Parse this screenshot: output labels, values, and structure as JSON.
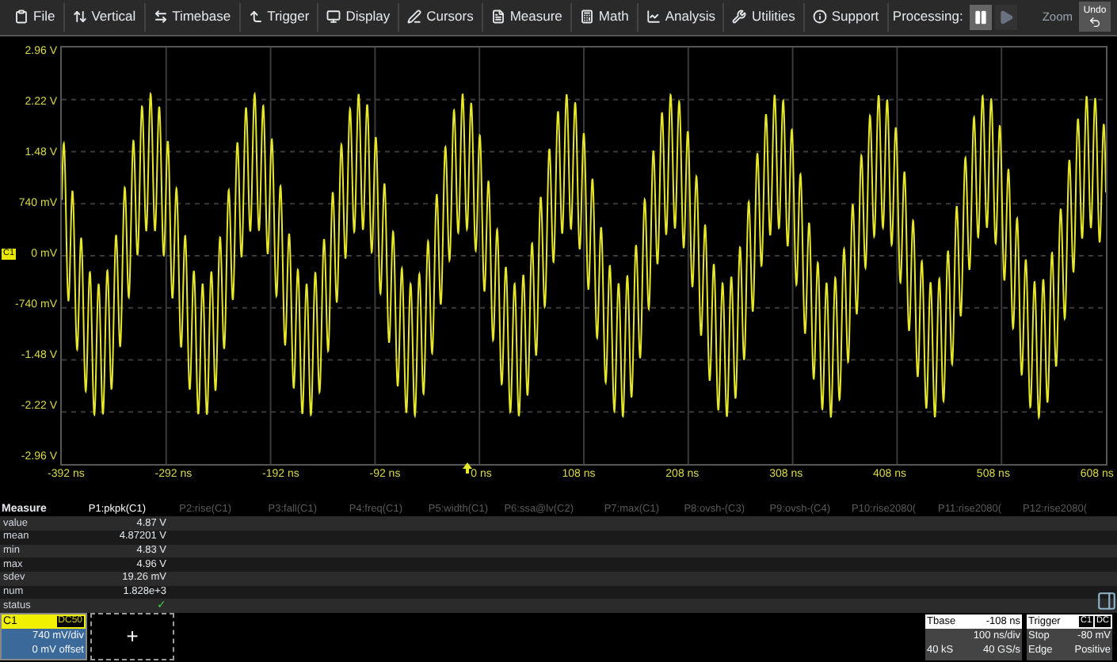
{
  "menu": [
    {
      "label": "File"
    },
    {
      "label": "Vertical"
    },
    {
      "label": "Timebase"
    },
    {
      "label": "Trigger"
    },
    {
      "label": "Display"
    },
    {
      "label": "Cursors"
    },
    {
      "label": "Measure"
    },
    {
      "label": "Math"
    },
    {
      "label": "Analysis"
    },
    {
      "label": "Utilities"
    },
    {
      "label": "Support"
    }
  ],
  "processing": {
    "label": "Processing:",
    "pause": {
      "disabled": false
    },
    "play": {
      "disabled": true
    }
  },
  "zoom": {
    "label": "Zoom"
  },
  "undo": {
    "label": "Undo"
  },
  "y_axis": [
    "2.96 V",
    "2.22 V",
    "1.48 V",
    "740 mV",
    "0 mV",
    "-740 mV",
    "-1.48 V",
    "-2.22 V",
    "-2.96 V"
  ],
  "channel_marker": "C1",
  "x_axis": [
    "-392 ns",
    "-292 ns",
    "-192 ns",
    "-92 ns",
    "0 ns",
    "108 ns",
    "208 ns",
    "308 ns",
    "408 ns",
    "508 ns",
    "608 ns"
  ],
  "measure": {
    "title": "Measure",
    "columns": [
      {
        "label": "P1:pkpk(C1)",
        "selected": true
      },
      {
        "label": "P2:rise(C1)",
        "selected": false
      },
      {
        "label": "P3:fall(C1)",
        "selected": false
      },
      {
        "label": "P4:freq(C1)",
        "selected": false
      },
      {
        "label": "P5:width(C1)",
        "selected": false
      },
      {
        "label": "P6:ssa@lv(C2)",
        "selected": false
      },
      {
        "label": "P7:max(C1)",
        "selected": false
      },
      {
        "label": "P8:ovsh-(C3)",
        "selected": false
      },
      {
        "label": "P9:ovsh-(C4)",
        "selected": false
      },
      {
        "label": "P10:rise2080(",
        "selected": false
      },
      {
        "label": "P11:rise2080(",
        "selected": false
      },
      {
        "label": "P12:rise2080(",
        "selected": false
      }
    ],
    "rows": [
      {
        "label": "value",
        "kind": "text",
        "value": "4.87 V"
      },
      {
        "label": "mean",
        "kind": "text",
        "value": "4.87201 V"
      },
      {
        "label": "min",
        "kind": "text",
        "value": "4.83 V"
      },
      {
        "label": "max",
        "kind": "text",
        "value": "4.96 V"
      },
      {
        "label": "sdev",
        "kind": "text",
        "value": "19.26 mV"
      },
      {
        "label": "num",
        "kind": "text",
        "value": "1.828e+3"
      },
      {
        "label": "status",
        "kind": "check",
        "value": "✓"
      }
    ]
  },
  "channel": {
    "name": "C1",
    "coupling": "DC50",
    "scale": "740 mV/div",
    "offset": "0 mV offset"
  },
  "add_button": "+",
  "timebase": {
    "title": "Tbase",
    "delay": "-108 ns",
    "scale": "100 ns/div",
    "samples": "40 kS",
    "rate": "40 GS/s"
  },
  "trigger": {
    "title": "Trigger",
    "source": "C1",
    "coupling": "DC",
    "mode": "Stop",
    "level": "-80 mV",
    "type": "Edge",
    "slope": "Positive"
  }
}
